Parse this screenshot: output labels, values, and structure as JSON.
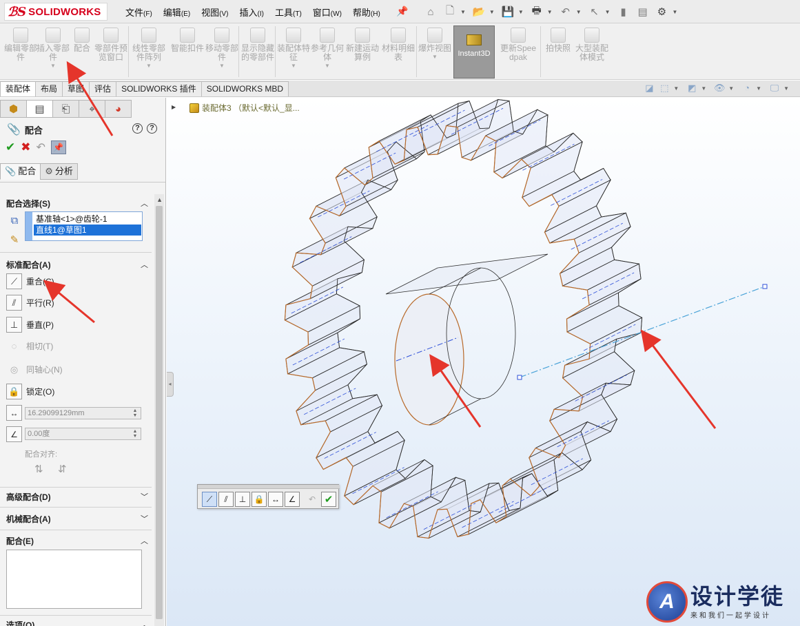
{
  "app": {
    "logo_mark": "ℬS",
    "logo_text": "SOLIDWORKS"
  },
  "menu": [
    {
      "label": "文件",
      "key": "(F)"
    },
    {
      "label": "编辑",
      "key": "(E)"
    },
    {
      "label": "视图",
      "key": "(V)"
    },
    {
      "label": "插入",
      "key": "(I)"
    },
    {
      "label": "工具",
      "key": "(T)"
    },
    {
      "label": "窗口",
      "key": "(W)"
    },
    {
      "label": "帮助",
      "key": "(H)"
    }
  ],
  "commands": [
    {
      "label": "编辑零部件"
    },
    {
      "label": "插入零部件"
    },
    {
      "label": "配合"
    },
    {
      "label": "零部件预览窗口"
    },
    {
      "label": "线性零部件阵列"
    },
    {
      "label": "智能扣件"
    },
    {
      "label": "移动零部件"
    },
    {
      "label": "显示隐藏的零部件"
    },
    {
      "label": "装配体特征"
    },
    {
      "label": "参考几何体"
    },
    {
      "label": "新建运动算例"
    },
    {
      "label": "材料明细表"
    },
    {
      "label": "爆炸视图"
    },
    {
      "label": "Instant3D"
    },
    {
      "label": "更新Speedpak"
    },
    {
      "label": "拍快照"
    },
    {
      "label": "大型装配体模式"
    }
  ],
  "tabs": [
    {
      "label": "装配体"
    },
    {
      "label": "布局"
    },
    {
      "label": "草图"
    },
    {
      "label": "评估"
    },
    {
      "label": "SOLIDWORKS 插件"
    },
    {
      "label": "SOLIDWORKS MBD"
    }
  ],
  "tree": {
    "root_label": "装配体3 （默认<默认_显..."
  },
  "property_manager": {
    "title": "配合",
    "subtabs": {
      "mates": "配合",
      "analysis": "分析"
    },
    "groups": {
      "selection": "配合选择(S)",
      "standard": "标准配合(A)",
      "advanced": "高级配合(D)",
      "mechanical": "机械配合(A)",
      "mates": "配合(E)",
      "options": "选项(O)"
    },
    "selections": [
      "基准轴<1>@齿轮-1",
      "直线1@草图1"
    ],
    "standard_mates": [
      {
        "label": "重合(C)",
        "icon": "coincident-icon",
        "enabled": true
      },
      {
        "label": "平行(R)",
        "icon": "parallel-icon",
        "enabled": true
      },
      {
        "label": "垂直(P)",
        "icon": "perpendicular-icon",
        "enabled": true
      },
      {
        "label": "相切(T)",
        "icon": "tangent-icon",
        "enabled": false
      },
      {
        "label": "同轴心(N)",
        "icon": "concentric-icon",
        "enabled": false
      },
      {
        "label": "锁定(O)",
        "icon": "lock-icon",
        "enabled": true
      }
    ],
    "distance_value": "16.29099129mm",
    "angle_value": "0.00度",
    "alignment_label": "配合对齐:"
  },
  "watermark": {
    "logo_letter": "A",
    "title": "设计学徒",
    "subtitle": "来和我们一起学设计"
  },
  "colors": {
    "brand_red": "#d6001c",
    "selection_blue": "#1e72d8",
    "annotation_red": "#e5352b",
    "gear_edge": "#b86a2a",
    "axis_line": "#4aa3d8"
  }
}
